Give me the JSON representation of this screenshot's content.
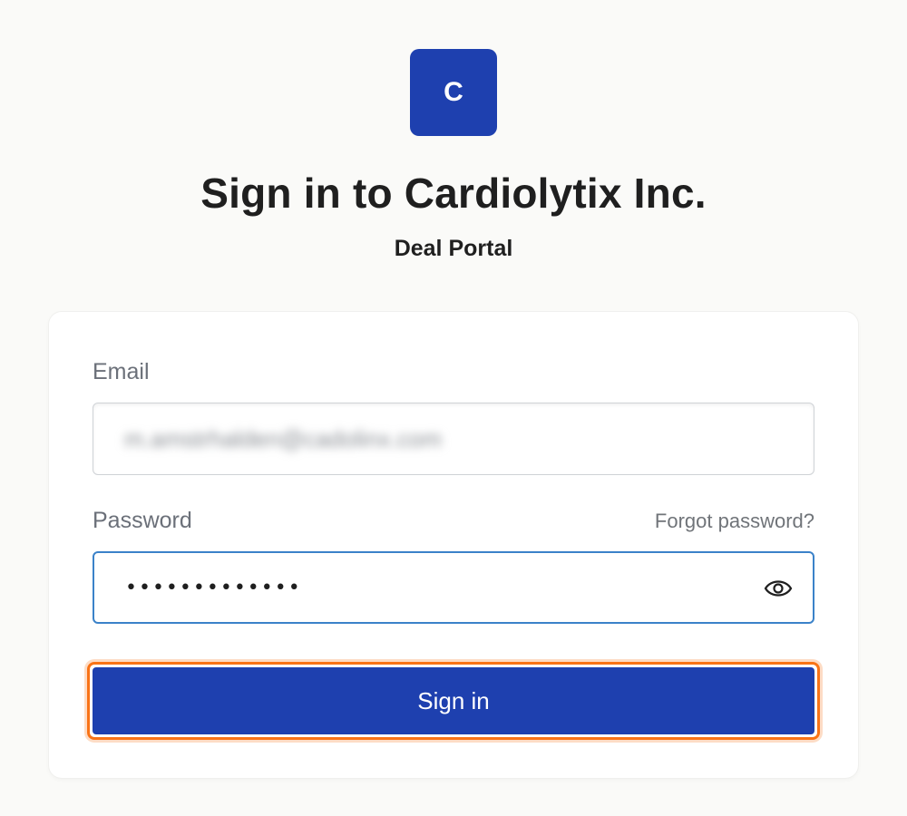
{
  "logo": {
    "letter": "C",
    "color": "#1e40af"
  },
  "title": "Sign in to Cardiolytix Inc.",
  "subtitle": "Deal Portal",
  "form": {
    "email_label": "Email",
    "email_value": "m.amstrhalden@cadolinx.com",
    "password_label": "Password",
    "forgot_label": "Forgot password?",
    "password_masked": "•••••••••••••",
    "show_password_icon": "eye-icon",
    "submit_label": "Sign in"
  },
  "colors": {
    "primary": "#1e40af",
    "focus_ring": "#3b82c9",
    "highlight": "#f97316"
  }
}
